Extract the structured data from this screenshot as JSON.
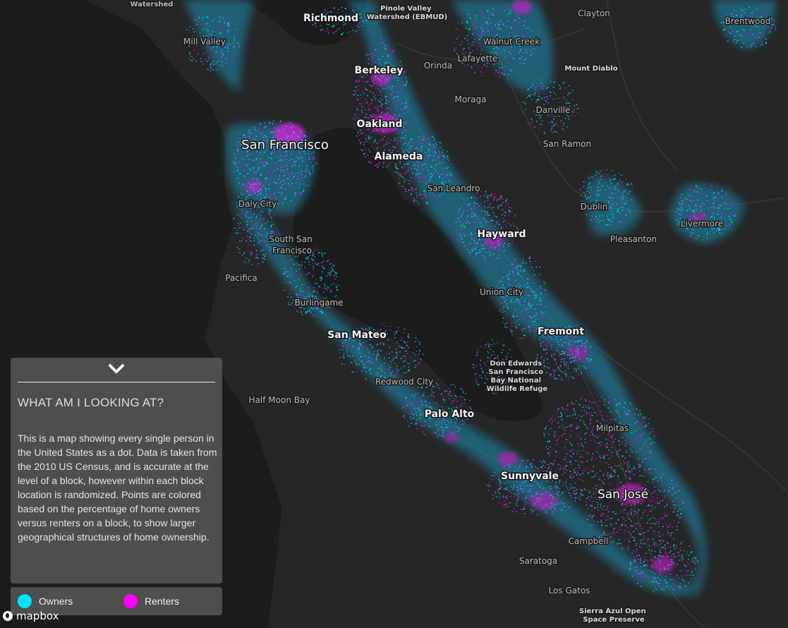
{
  "colors": {
    "background": "#1e1e1e",
    "land": "#262626",
    "water": "#1b1b1b",
    "owners": "#00e5ff",
    "renters": "#ff00ff"
  },
  "map": {
    "labels": {
      "watershed": "Watershed",
      "richmond": "Richmond",
      "pinole": "Pinole Valley\nWatershed (EBMUD)",
      "clayton": "Clayton",
      "brentwood": "Brentwood",
      "mill_valley": "Mill Valley",
      "walnut_creek": "Walnut Creek",
      "orinda": "Orinda",
      "lafayette": "Lafayette",
      "berkeley": "Berkeley",
      "mount_diablo": "Mount Diablo",
      "moraga": "Moraga",
      "danville": "Danville",
      "oakland": "Oakland",
      "san_francisco": "San Francisco",
      "alameda": "Alameda",
      "san_ramon": "San Ramon",
      "san_leandro": "San Leandro",
      "daly_city": "Daly City",
      "dublin": "Dublin",
      "livermore": "Livermore",
      "hayward": "Hayward",
      "south_sf": "South San\nFrancisco",
      "pleasanton": "Pleasanton",
      "pacifica": "Pacifica",
      "union_city": "Union City",
      "burlingame": "Burlingame",
      "fremont": "Fremont",
      "san_mateo": "San Mateo",
      "don_edwards": "Don Edwards\nSan Francisco\nBay National\nWildlife Refuge",
      "redwood_city": "Redwood City",
      "half_moon_bay": "Half Moon Bay",
      "palo_alto": "Palo Alto",
      "milpitas": "Milpitas",
      "sunnyvale": "Sunnyvale",
      "san_jose": "San José",
      "campbell": "Campbell",
      "saratoga": "Saratoga",
      "los_gatos": "Los Gatos",
      "sierra_azul": "Sierra Azul Open\nSpace Preserve"
    }
  },
  "panel": {
    "toggle_icon": "chevron-down-icon",
    "heading": "WHAT AM I LOOKING AT?",
    "body": "This is a map showing every single person in the United States as a dot. Data is taken from the 2010 US Census, and is accurate at the level of a block, however within each block location is randomized. Points are colored based on the percentage of home owners versus renters on a block, to show larger geographical structures of home ownership."
  },
  "legend": {
    "items": [
      {
        "label": "Owners",
        "color": "#00e5ff"
      },
      {
        "label": "Renters",
        "color": "#ff00ff"
      }
    ]
  },
  "attribution": {
    "logo_text": "mapbox"
  }
}
